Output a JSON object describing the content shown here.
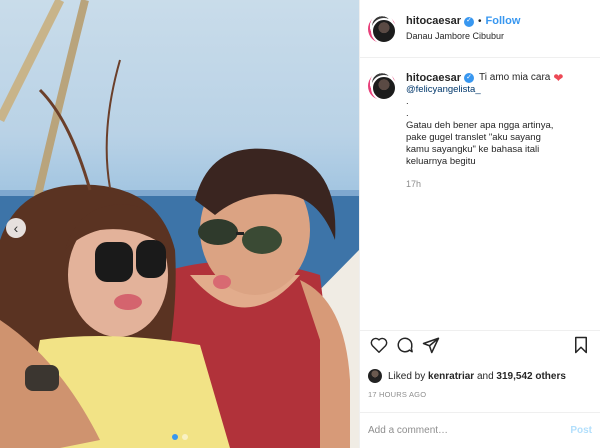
{
  "post": {
    "username": "hitocaesar",
    "follow_label": "Follow",
    "separator": "•",
    "location": "Danau Jambore Cibubur",
    "caption": {
      "first_text": "Ti amo mia cara",
      "emoji": "❤",
      "mention": "@felicyangelista_",
      "lines": [
        ".",
        ".",
        "Gatau deh bener apa ngga artinya,",
        "pake gugel translet \"aku sayang",
        "kamu sayangku\" ke bahasa itali",
        "keluarnya begitu"
      ],
      "time": "17h"
    },
    "likes": {
      "prefix": "Liked by",
      "first_liker": "kenratriar",
      "connector": "and",
      "others": "319,542 others"
    },
    "timestamp": "17 HOURS AGO",
    "comment": {
      "placeholder": "Add a comment…",
      "post_label": "Post"
    }
  },
  "carousel": {
    "prev_glyph": "‹",
    "slide_count": 2,
    "active_slide": 1
  },
  "icons": {
    "verified": "verified-badge-icon",
    "like": "heart-icon",
    "comment": "comment-icon",
    "share": "paper-plane-icon",
    "save": "bookmark-icon"
  },
  "colors": {
    "accent": "#3897f0",
    "heart": "#ed4956",
    "muted": "#8e8e8e",
    "post_disabled": "#b2dffc"
  }
}
